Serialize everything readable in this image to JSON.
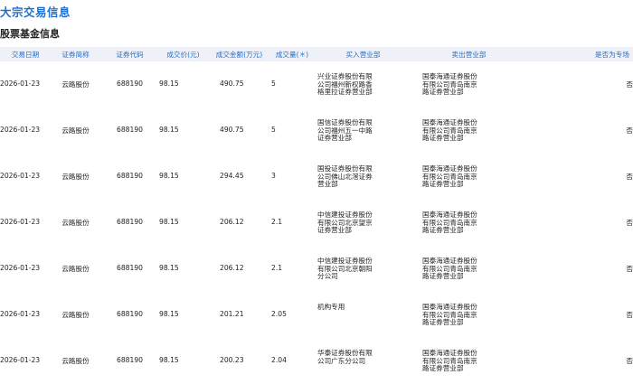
{
  "page_title": "大宗交易信息",
  "section_title": "股票基金信息",
  "table": {
    "headers": [
      "交易日期",
      "证券简称",
      "证券代码",
      "成交价(元)",
      "成交金额(万元)",
      "成交量(＊)",
      "买入营业部",
      "卖出营业部",
      "是否为专场"
    ],
    "rows": [
      {
        "date": "2026-01-23",
        "name": "云路股份",
        "code": "688190",
        "price": "98.15",
        "amount": "490.75",
        "volume": "5",
        "buyer": "兴业证券股份有限公司福州新权路香格里拉证券营业部",
        "seller": "国泰海通证券股份有限公司青岛南京路证券营业部",
        "special": "否"
      },
      {
        "date": "2026-01-23",
        "name": "云路股份",
        "code": "688190",
        "price": "98.15",
        "amount": "490.75",
        "volume": "5",
        "buyer": "国信证券股份有限公司福州五一中路证券营业部",
        "seller": "国泰海通证券股份有限公司青岛南京路证券营业部",
        "special": "否"
      },
      {
        "date": "2026-01-23",
        "name": "云路股份",
        "code": "688190",
        "price": "98.15",
        "amount": "294.45",
        "volume": "3",
        "buyer": "国投证券股份有限公司佛山北滘证券营业部",
        "seller": "国泰海通证券股份有限公司青岛南京路证券营业部",
        "special": "否"
      },
      {
        "date": "2026-01-23",
        "name": "云路股份",
        "code": "688190",
        "price": "98.15",
        "amount": "206.12",
        "volume": "2.1",
        "buyer": "中信建投证券股份有限公司北京望京证券营业部",
        "seller": "国泰海通证券股份有限公司青岛南京路证券营业部",
        "special": "否"
      },
      {
        "date": "2026-01-23",
        "name": "云路股份",
        "code": "688190",
        "price": "98.15",
        "amount": "206.12",
        "volume": "2.1",
        "buyer": "中信建投证券股份有限公司北京朝阳分公司",
        "seller": "国泰海通证券股份有限公司青岛南京路证券营业部",
        "special": "否"
      },
      {
        "date": "2026-01-23",
        "name": "云路股份",
        "code": "688190",
        "price": "98.15",
        "amount": "201.21",
        "volume": "2.05",
        "buyer": "机构专用",
        "seller": "国泰海通证券股份有限公司青岛南京路证券营业部",
        "special": "否"
      },
      {
        "date": "2026-01-23",
        "name": "云路股份",
        "code": "688190",
        "price": "98.15",
        "amount": "200.23",
        "volume": "2.04",
        "buyer": "华泰证券股份有限公司广东分公司",
        "seller": "国泰海通证券股份有限公司青岛南京路证券营业部",
        "special": "否"
      }
    ]
  },
  "colors": {
    "accent": "#1f6fd0",
    "header_bg": "#eef2f8"
  }
}
